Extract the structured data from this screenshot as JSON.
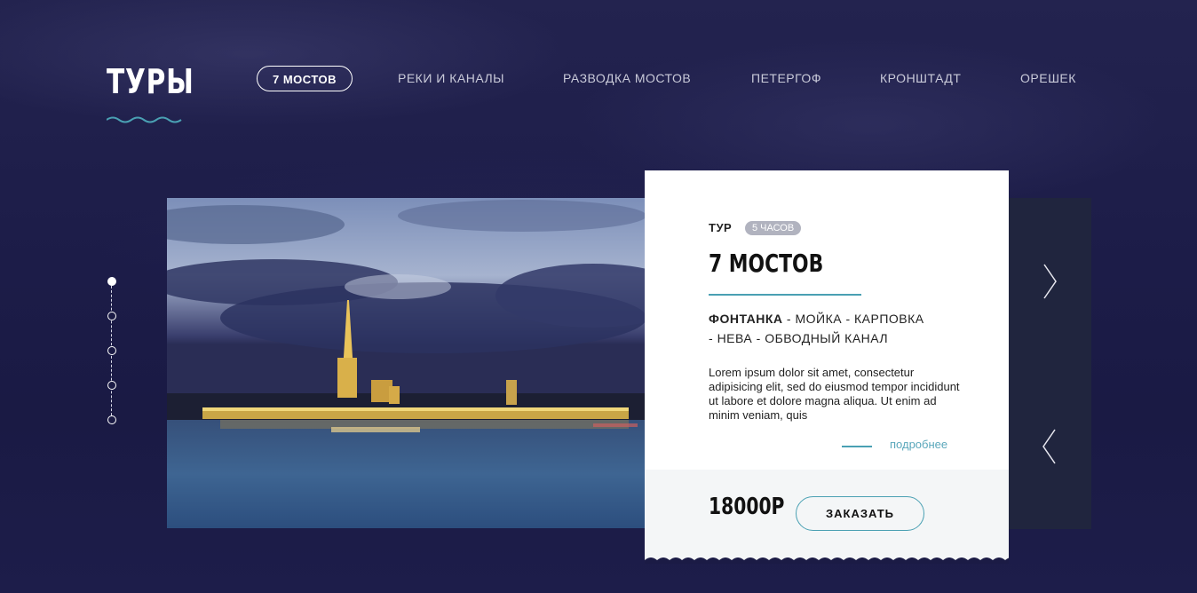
{
  "page_title": "ТУРЫ",
  "nav": {
    "items": [
      {
        "label": "7 МОСТОВ",
        "active": true
      },
      {
        "label": "РЕКИ И КАНАЛЫ",
        "active": false
      },
      {
        "label": "РАЗВОДКА МОСТОВ",
        "active": false
      },
      {
        "label": "ПЕТЕРГОФ",
        "active": false
      },
      {
        "label": "КРОНШТАДТ",
        "active": false
      },
      {
        "label": "ОРЕШЕК",
        "active": false
      }
    ]
  },
  "pager": {
    "count": 5,
    "active_index": 0
  },
  "card": {
    "tour_label": "ТУР",
    "duration_badge": "5 ЧАСОВ",
    "title": "7 МОСТОВ",
    "route": {
      "stops": [
        "ФОНТАНКА",
        "МОЙКА",
        "КАРПОВКА",
        "НЕВА",
        "ОБВОДНЫЙ КАНАЛ"
      ],
      "separator": "-"
    },
    "description": "Lorem ipsum dolor sit amet, consectetur adipisicing elit, sed do eiusmod tempor incididunt ut labore et dolore magna aliqua. Ut enim ad minim veniam, quis",
    "more_link": "подробнее",
    "price": "18000Р",
    "order_button": "ЗАКАЗАТЬ"
  },
  "icons": {
    "next": "chevron-right-icon",
    "prev": "chevron-left-icon",
    "wave": "wave-icon"
  },
  "colors": {
    "background": "#1b1b45",
    "accent": "#4aa0b3",
    "card": "#ffffff",
    "card_footer": "#f4f6f7",
    "badge": "#b1b3bf"
  }
}
